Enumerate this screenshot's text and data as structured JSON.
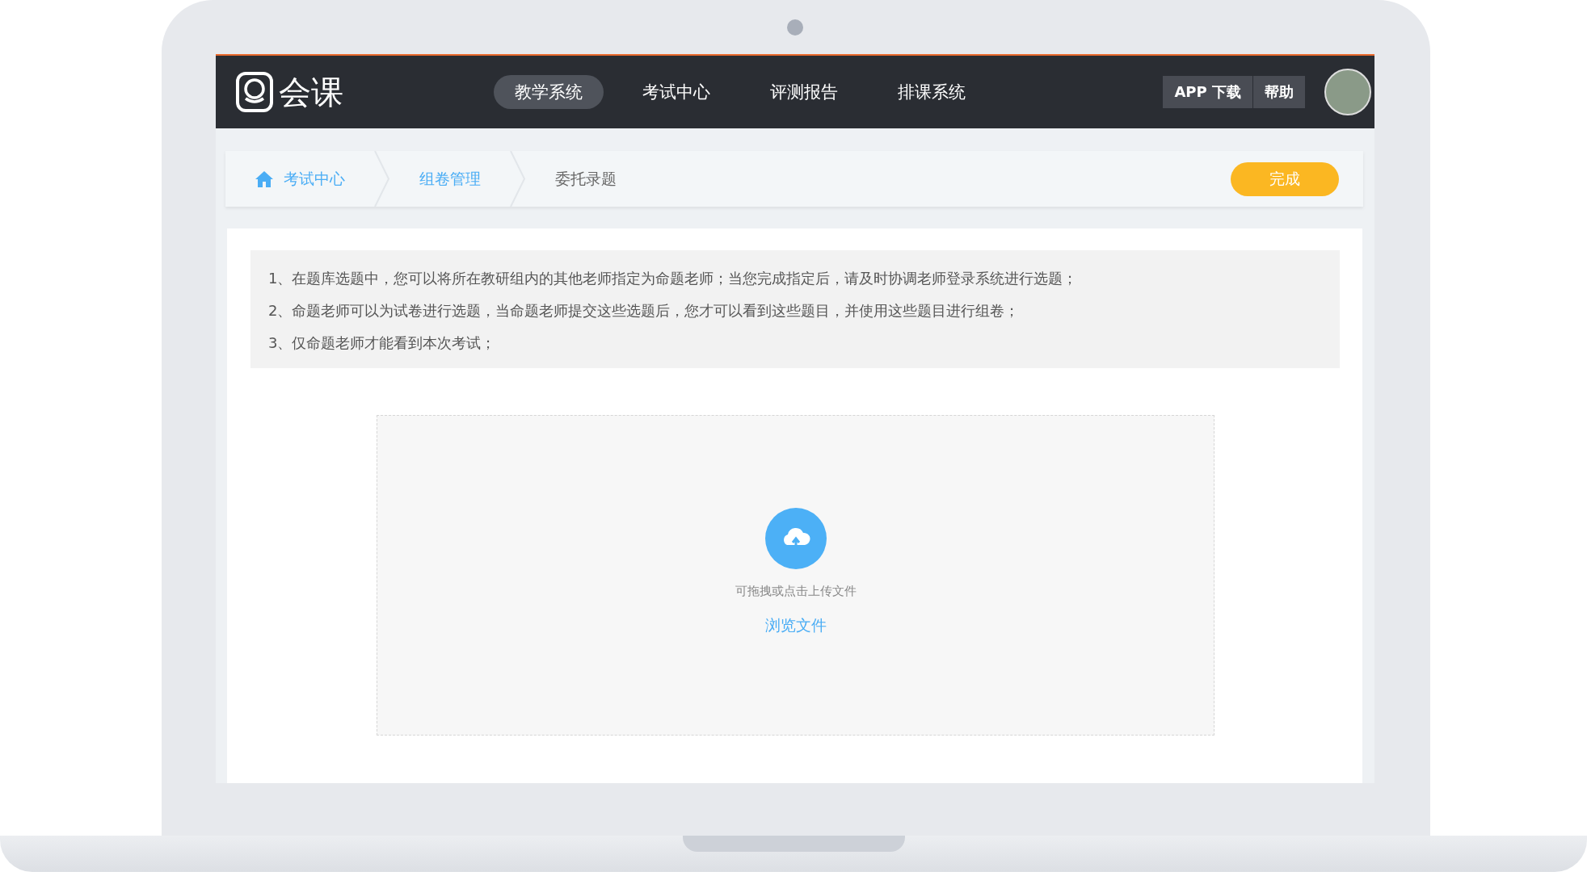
{
  "brand": {
    "name": "会课"
  },
  "nav": [
    {
      "label": "教学系统",
      "selected": true
    },
    {
      "label": "考试中心",
      "selected": false
    },
    {
      "label": "评测报告",
      "selected": false
    },
    {
      "label": "排课系统",
      "selected": false
    }
  ],
  "header_buttons": [
    "APP 下载",
    "帮助"
  ],
  "breadcrumb": [
    {
      "label": "考试中心",
      "kind": "home",
      "current": false
    },
    {
      "label": "组卷管理",
      "kind": "link",
      "current": false
    },
    {
      "label": "委托录题",
      "kind": "link",
      "current": true
    }
  ],
  "done_button": "完成",
  "notes": [
    "1、在题库选题中，您可以将所在教研组内的其他老师指定为命题老师；当您完成指定后，请及时协调老师登录系统进行选题；",
    "2、命题老师可以为试卷进行选题，当命题老师提交这些选题后，您才可以看到这些题目，并使用这些题目进行组卷；",
    "3、仅命题老师才能看到本次考试；"
  ],
  "upload": {
    "hint": "可拖拽或点击上传文件",
    "link": "浏览文件"
  }
}
